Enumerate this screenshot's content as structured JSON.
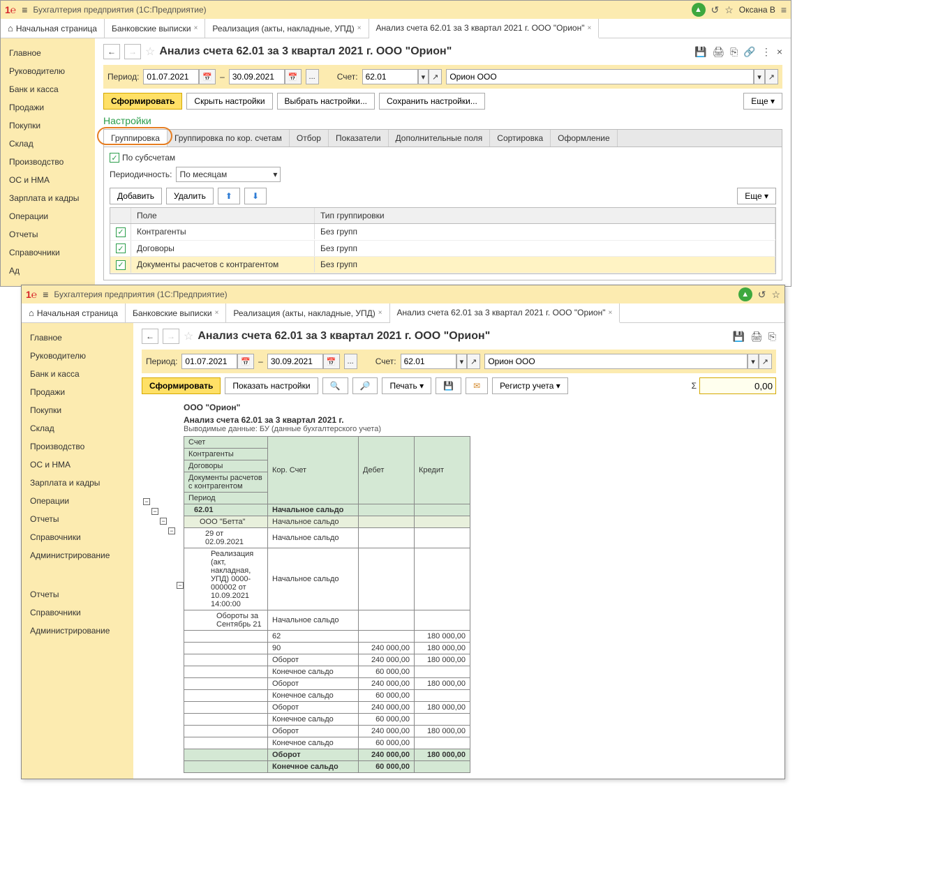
{
  "app": {
    "title": "Бухгалтерия предприятия  (1С:Предприятие)",
    "user": "Оксана В"
  },
  "tabs": [
    {
      "label": "Начальная страница",
      "home": true
    },
    {
      "label": "Банковские выписки"
    },
    {
      "label": "Реализация (акты, накладные, УПД)"
    },
    {
      "label": "Анализ счета 62.01 за 3 квартал 2021 г. ООО \"Орион\"",
      "active": true
    }
  ],
  "sidebar": {
    "items": [
      "Главное",
      "Руководителю",
      "Банк и касса",
      "Продажи",
      "Покупки",
      "Склад",
      "Производство",
      "ОС и НМА",
      "Зарплата и кадры",
      "Операции",
      "Отчеты",
      "Справочники",
      "Ад"
    ]
  },
  "sidebar2": {
    "items": [
      "Главное",
      "Руководителю",
      "Банк и касса",
      "Продажи",
      "Покупки",
      "Склад",
      "Производство",
      "ОС и НМА",
      "Зарплата и кадры",
      "Операции",
      "Отчеты",
      "Справочники",
      "Администрирование",
      "",
      "Отчеты",
      "Справочники",
      "Администрирование"
    ]
  },
  "page": {
    "title": "Анализ счета 62.01 за 3 квартал 2021 г. ООО \"Орион\"",
    "period_label": "Период:",
    "date_from": "01.07.2021",
    "date_to": "30.09.2021",
    "dash": "–",
    "account_label": "Счет:",
    "account": "62.01",
    "org": "Орион ООО",
    "dots": "...",
    "btn_form": "Сформировать",
    "btn_hide": "Скрыть настройки",
    "btn_choose": "Выбрать настройки...",
    "btn_save": "Сохранить настройки...",
    "btn_more": "Еще",
    "settings": "Настройки"
  },
  "settings_tabs": [
    "Группировка",
    "Группировка по кор. счетам",
    "Отбор",
    "Показатели",
    "Дополнительные поля",
    "Сортировка",
    "Оформление"
  ],
  "grouping": {
    "by_sub": "По субсчетам",
    "period_label": "Периодичность:",
    "period_value": "По месяцам",
    "btn_add": "Добавить",
    "btn_del": "Удалить",
    "col_field": "Поле",
    "col_type": "Тип группировки",
    "rows": [
      {
        "field": "Контрагенты",
        "type": "Без групп"
      },
      {
        "field": "Договоры",
        "type": "Без групп"
      },
      {
        "field": "Документы расчетов с контрагентом",
        "type": "Без групп",
        "sel": true
      }
    ]
  },
  "win2": {
    "btn_show": "Показать настройки",
    "btn_print": "Печать",
    "btn_register": "Регистр учета",
    "sigma": "Σ",
    "sum": "0,00"
  },
  "report": {
    "org": "ООО \"Орион\"",
    "title": "Анализ счета 62.01 за 3 квартал 2021 г.",
    "subtitle": "Выводимые данные:  БУ (данные бухгалтерского учета)",
    "headers": {
      "acct": "Счет",
      "cor": "Кор. Счет",
      "debit": "Дебет",
      "credit": "Кредит",
      "контр": "Контрагенты",
      "дог": "Договоры",
      "док": "Документы расчетов с контрагентом",
      "пер": "Период"
    },
    "rows": [
      {
        "lvl": 1,
        "c1": "62.01",
        "c2": "Начальное сальдо"
      },
      {
        "lvl": 2,
        "c1": "ООО \"Бетта\"",
        "c2": "Начальное сальдо",
        "hl": true
      },
      {
        "lvl": 3,
        "c1": "29 от 02.09.2021",
        "c2": "Начальное сальдо"
      },
      {
        "lvl": 4,
        "c1": "Реализация (акт, накладная, УПД) 0000-000002 от 10.09.2021 14:00:00",
        "c2": "Начальное сальдо"
      },
      {
        "lvl": 5,
        "c1": "Обороты за Сентябрь 21",
        "c2": "Начальное сальдо"
      },
      {
        "lvl": 6,
        "c2": "62",
        "credit": "180 000,00"
      },
      {
        "lvl": 6,
        "c2": "90",
        "debit": "240 000,00",
        "credit": "180 000,00"
      },
      {
        "lvl": 6,
        "c2": "Оборот",
        "debit": "240 000,00",
        "credit": "180 000,00"
      },
      {
        "lvl": 6,
        "c2": "Конечное сальдо",
        "debit": "60 000,00"
      },
      {
        "lvl": 5,
        "c2": "Оборот",
        "debit": "240 000,00",
        "credit": "180 000,00"
      },
      {
        "lvl": 5,
        "c2": "Конечное сальдо",
        "debit": "60 000,00"
      },
      {
        "lvl": 4,
        "c2": "Оборот",
        "debit": "240 000,00",
        "credit": "180 000,00"
      },
      {
        "lvl": 4,
        "c2": "Конечное сальдо",
        "debit": "60 000,00"
      },
      {
        "lvl": 3,
        "c2": "Оборот",
        "debit": "240 000,00",
        "credit": "180 000,00"
      },
      {
        "lvl": 3,
        "c2": "Конечное сальдо",
        "debit": "60 000,00"
      },
      {
        "lvl": 0,
        "c2": "Оборот",
        "debit": "240 000,00",
        "credit": "180 000,00",
        "total": true
      },
      {
        "lvl": 0,
        "c2": "Конечное сальдо",
        "debit": "60 000,00",
        "total": true
      }
    ]
  }
}
